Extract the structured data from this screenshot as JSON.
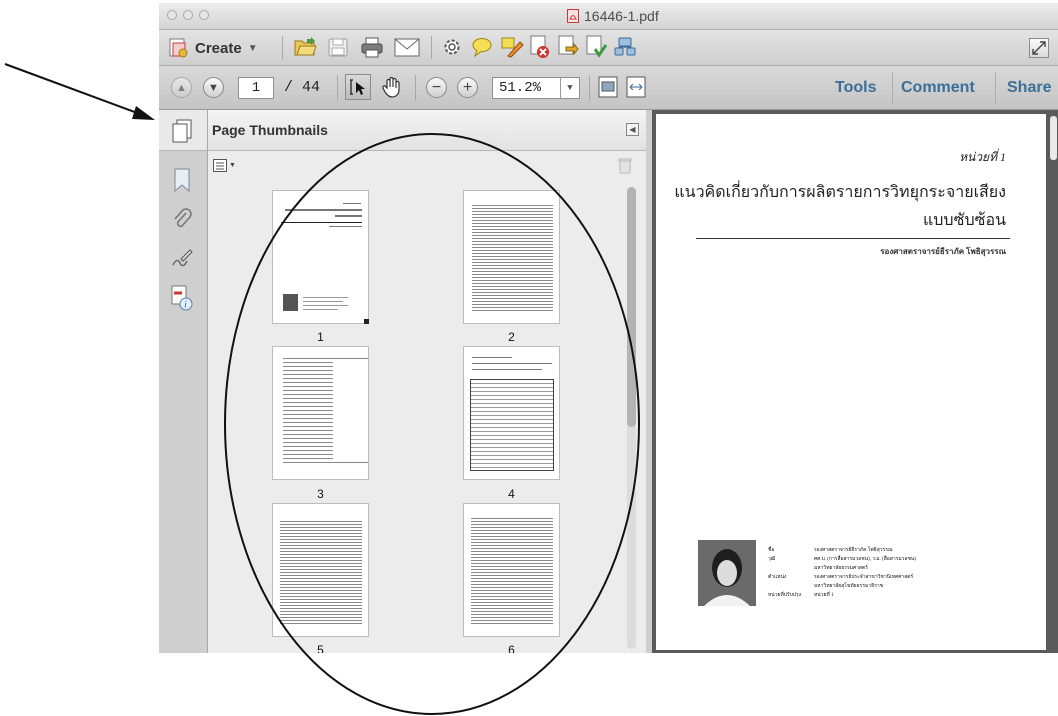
{
  "window": {
    "title": "16446-1.pdf"
  },
  "toolbar": {
    "create_label": "Create",
    "page_current": "1",
    "page_total": "/ 44",
    "zoom": "51.2%",
    "links": [
      "Tools",
      "Comment",
      "Share"
    ]
  },
  "thumbnails_panel": {
    "title": "Page Thumbnails",
    "pages": [
      "1",
      "2",
      "3",
      "4",
      "5",
      "6"
    ]
  },
  "document_page": {
    "unit_label": "หน่วยที่ 1",
    "heading_line1": "แนวคิดเกี่ยวกับการผลิตรายการวิทยุกระจายเสียง",
    "heading_line2": "แบบซับซ้อน",
    "author": "รองศาสตราจารย์ธีราภัค โพธิสุวรรณ",
    "info": [
      {
        "k": "ชื่อ",
        "v": "รองศาสตราจารย์ธีราภัค โพธิสุวรรณ"
      },
      {
        "k": "วุฒิ",
        "v": "ศศ.บ. (การสื่อสารมวลชน), ว.ม. (สื่อสารมวลชน)"
      },
      {
        "k": "",
        "v": "มหาวิทยาลัยธรรมศาสตร์"
      },
      {
        "k": "ตำแหน่ง",
        "v": "รองศาสตราจารย์ประจำสาขาวิชานิเทศศาสตร์"
      },
      {
        "k": "",
        "v": "มหาวิทยาลัยสุโขทัยธรรมาธิราช"
      },
      {
        "k": "หน่วยที่ปรับปรุง",
        "v": "หน่วยที่ 1"
      }
    ]
  },
  "colors": {
    "link_blue": "#3c6f97",
    "pdf_red": "#c8393a"
  }
}
